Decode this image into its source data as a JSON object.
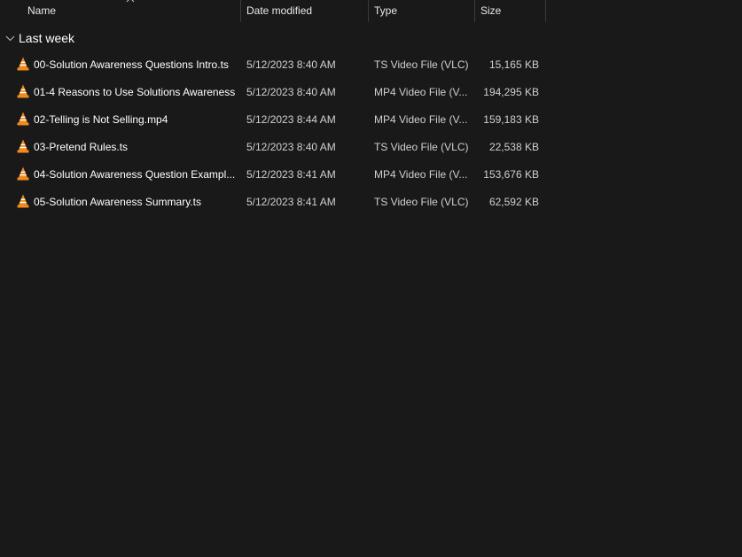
{
  "columns": {
    "name": "Name",
    "date": "Date modified",
    "type": "Type",
    "size": "Size"
  },
  "group": {
    "label": "Last week",
    "icon": "chevron-down-icon"
  },
  "files": [
    {
      "name": "00-Solution Awareness Questions Intro.ts",
      "date": "5/12/2023 8:40 AM",
      "type": "TS Video File (VLC)",
      "size": "15,165 KB"
    },
    {
      "name": "01-4 Reasons to Use Solutions Awareness...",
      "date": "5/12/2023 8:40 AM",
      "type": "MP4 Video File (V...",
      "size": "194,295 KB"
    },
    {
      "name": "02-Telling is Not Selling.mp4",
      "date": "5/12/2023 8:44 AM",
      "type": "MP4 Video File (V...",
      "size": "159,183 KB"
    },
    {
      "name": "03-Pretend Rules.ts",
      "date": "5/12/2023 8:40 AM",
      "type": "TS Video File (VLC)",
      "size": "22,538 KB"
    },
    {
      "name": "04-Solution Awareness Question Exampl...",
      "date": "5/12/2023 8:41 AM",
      "type": "MP4 Video File (V...",
      "size": "153,676 KB"
    },
    {
      "name": "05-Solution Awareness Summary.ts",
      "date": "5/12/2023 8:41 AM",
      "type": "TS Video File (VLC)",
      "size": "62,592 KB"
    }
  ],
  "colors": {
    "background": "#191919",
    "vlc_orange": "#f08a1c",
    "vlc_stripe": "#ffffff"
  }
}
